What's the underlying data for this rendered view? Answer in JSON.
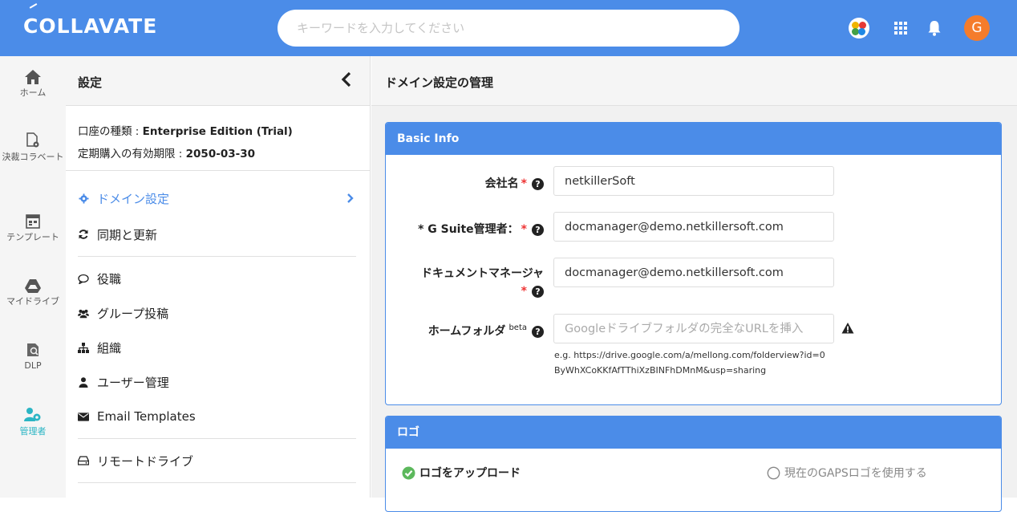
{
  "header": {
    "logo": "COLLAVATE",
    "search_placeholder": "キーワードを入力してください",
    "avatar_letter": "G"
  },
  "leftnav": {
    "items": [
      {
        "label": "ホーム",
        "icon": "home-icon"
      },
      {
        "label": "決裁コラベート",
        "icon": "approval-icon"
      },
      {
        "label": "テンプレート",
        "icon": "template-icon"
      },
      {
        "label": "マイドライブ",
        "icon": "drive-icon"
      },
      {
        "label": "DLP",
        "icon": "dlp-icon"
      },
      {
        "label": "管理者",
        "icon": "admin-icon"
      }
    ],
    "active_color": "#2bb5c4"
  },
  "settings": {
    "title": "設定",
    "account_type_label": "口座の種類 : ",
    "account_type_value": "Enterprise Edition (Trial)",
    "expiry_label": "定期購入の有効期限 : ",
    "expiry_value": "2050-03-30",
    "menu": [
      {
        "label": "ドメイン設定",
        "icon": "gear-icon",
        "active": true
      },
      {
        "label": "同期と更新",
        "icon": "sync-icon"
      },
      {
        "label": "役職",
        "icon": "comment-icon"
      },
      {
        "label": "グループ投稿",
        "icon": "users-icon"
      },
      {
        "label": "組織",
        "icon": "sitemap-icon"
      },
      {
        "label": "ユーザー管理",
        "icon": "user-icon"
      },
      {
        "label": "Email Templates",
        "icon": "envelope-icon"
      },
      {
        "label": "リモートドライブ",
        "icon": "hdd-icon"
      }
    ]
  },
  "main": {
    "title": "ドメイン設定の管理",
    "basic_info": {
      "heading": "Basic Info",
      "company_label": "会社名",
      "company_value": "netkillerSoft",
      "gsuite_label": "* G Suite管理者：",
      "gsuite_value": "docmanager@demo.netkillersoft.com",
      "docmgr_label_line1": "ドキュメントマネージャ",
      "docmgr_value": "docmanager@demo.netkillersoft.com",
      "home_label": "ホームフォルダ",
      "home_beta": "beta",
      "home_placeholder": "Googleドライブフォルダの完全なURLを挿入",
      "hint_line1": "e.g. https://drive.google.com/a/mellong.com/folderview?id=0",
      "hint_line2": "ByWhXCoKKfAfTThiXzBINFhDMnM&usp=sharing",
      "required_mark": "*",
      "help_mark": "?"
    },
    "logo": {
      "heading": "ロゴ",
      "upload_label": "ロゴをアップロード",
      "gaps_label": "現在のGAPSロゴを使用する"
    }
  },
  "colors": {
    "primary": "#4b8ce8",
    "required": "#e33333",
    "check": "#5cb85c",
    "avatar": "#f57c2b"
  }
}
